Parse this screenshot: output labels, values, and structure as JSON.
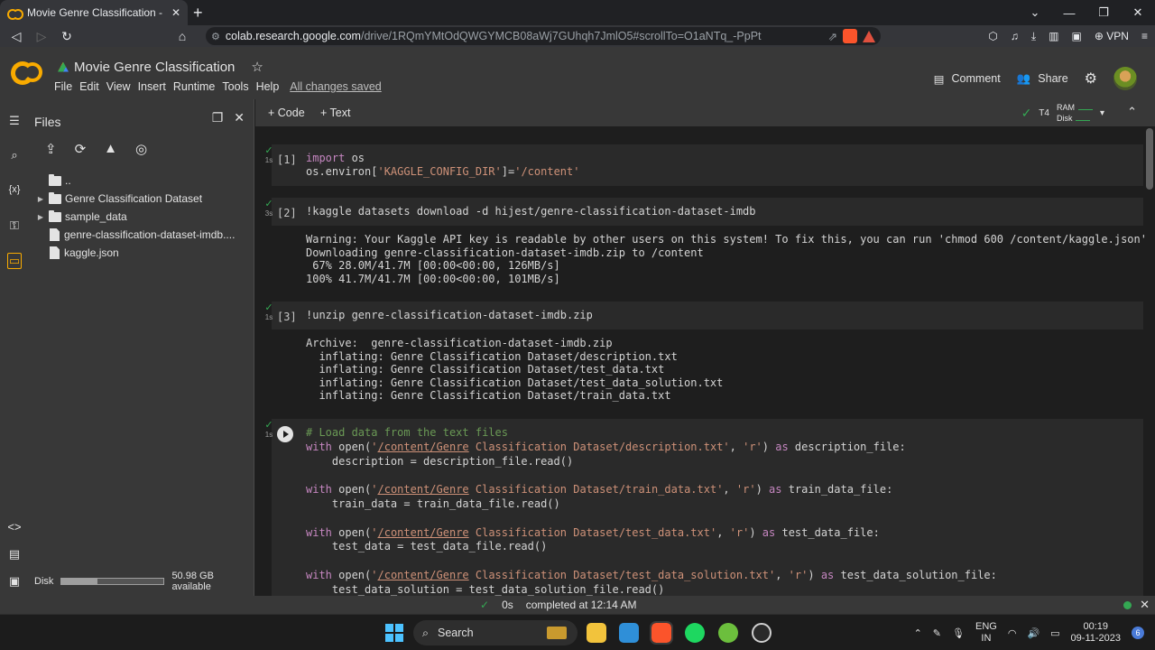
{
  "browser": {
    "tab_title": "Movie Genre Classification - Cola",
    "url_host": "colab.research.google.com",
    "url_path": "/drive/1RQmYMtOdQWGYMCB08aWj7GUhqh7JmlO5#scrollTo=O1aNTq_-PpPt",
    "vpn_label": "VPN"
  },
  "header": {
    "notebook_title": "Movie Genre Classification",
    "menu": [
      "File",
      "Edit",
      "View",
      "Insert",
      "Runtime",
      "Tools",
      "Help"
    ],
    "saved_status": "All changes saved",
    "comment_label": "Comment",
    "share_label": "Share"
  },
  "files_panel": {
    "title": "Files",
    "items": [
      {
        "label": "..",
        "type": "folder-up"
      },
      {
        "label": "Genre Classification Dataset",
        "type": "folder"
      },
      {
        "label": "sample_data",
        "type": "folder"
      },
      {
        "label": "genre-classification-dataset-imdb....",
        "type": "file"
      },
      {
        "label": "kaggle.json",
        "type": "file"
      }
    ],
    "disk_label": "Disk",
    "disk_available": "50.98 GB available",
    "disk_used_fraction": 0.35
  },
  "toolbar": {
    "add_code": "+ Code",
    "add_text": "+ Text",
    "runtime_type": "T4",
    "ram_label": "RAM",
    "disk_label": "Disk"
  },
  "cells": [
    {
      "prompt": "[1]",
      "time": "1s"
    },
    {
      "prompt": "[2]",
      "time": "3s",
      "output": "Warning: Your Kaggle API key is readable by other users on this system! To fix this, you can run 'chmod 600 /content/kaggle.json'\nDownloading genre-classification-dataset-imdb.zip to /content\n 67% 28.0M/41.7M [00:00<00:00, 126MB/s]\n100% 41.7M/41.7M [00:00<00:00, 101MB/s]"
    },
    {
      "prompt": "[3]",
      "time": "1s",
      "output": "Archive:  genre-classification-dataset-imdb.zip\n  inflating: Genre Classification Dataset/description.txt  \n  inflating: Genre Classification Dataset/test_data.txt  \n  inflating: Genre Classification Dataset/test_data_solution.txt  \n  inflating: Genre Classification Dataset/train_data.txt  "
    },
    {
      "prompt": "",
      "time": "1s"
    }
  ],
  "status": {
    "elapsed": "0s",
    "completed": "completed at 12:14 AM"
  },
  "taskbar": {
    "search_label": "Search",
    "lang_line1": "ENG",
    "lang_line2": "IN",
    "time": "00:19",
    "date": "09-11-2023",
    "notif_count": "6"
  }
}
